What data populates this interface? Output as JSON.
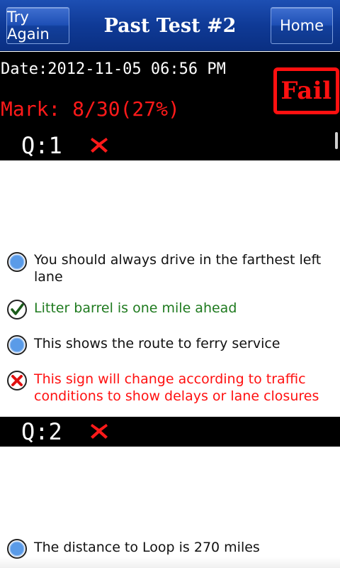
{
  "titlebar": {
    "title": "Past Test #2",
    "try_again_label": "Try Again",
    "home_label": "Home"
  },
  "result": {
    "date": "Date:2012-11-05 06:56 PM",
    "mark": "Mark: 8/30(27%)",
    "stamp": "Fail"
  },
  "questions": [
    {
      "label": "Q:1",
      "status_icon": "red-x-icon",
      "answers": [
        {
          "text": "You should always drive in the farthest left lane",
          "state": "unselected",
          "icon": "radio-blue-icon"
        },
        {
          "text": "Litter barrel is one mile ahead",
          "state": "correct",
          "icon": "check-icon"
        },
        {
          "text": "This shows the route to ferry service",
          "state": "unselected",
          "icon": "radio-blue-icon"
        },
        {
          "text": "This sign will change according to traffic conditions to show delays or lane closures",
          "state": "chosen-wrong",
          "icon": "x-radio-icon"
        }
      ]
    },
    {
      "label": "Q:2",
      "status_icon": "red-x-icon",
      "answers": [
        {
          "text": "The distance to Loop is 270 miles",
          "state": "unselected",
          "icon": "radio-blue-icon"
        }
      ]
    }
  ],
  "colors": {
    "titlebar": "#0f3a96",
    "fail_red": "#ff1010",
    "correct_green": "#1e7a1e"
  }
}
